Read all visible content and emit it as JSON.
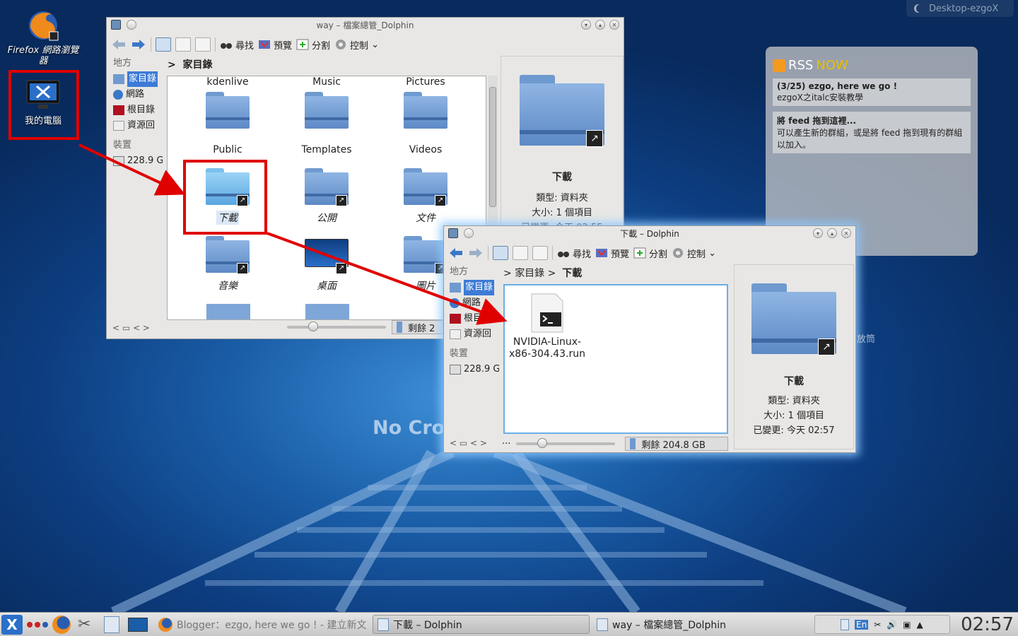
{
  "desktop": {
    "activity_label": "Desktop-ezgoX",
    "watermark": "No Cros",
    "icons": [
      {
        "label": "Firefox 網路瀏覽器"
      },
      {
        "label": "我的電腦"
      }
    ]
  },
  "win1": {
    "title": "way – 檔案總管_Dolphin",
    "toolbar": {
      "find": "尋找",
      "preview": "預覽",
      "split": "分割",
      "control": "控制"
    },
    "breadcrumb": [
      "家目錄"
    ],
    "places_header": "地方",
    "places": [
      "家目錄",
      "網路",
      "根目錄",
      "資源回"
    ],
    "devices_header": "裝置",
    "device": "228.9 G",
    "items": [
      {
        "label": "kdenlive"
      },
      {
        "label": "Music"
      },
      {
        "label": "Pictures"
      },
      {
        "label": "Public"
      },
      {
        "label": "Templates"
      },
      {
        "label": "Videos"
      },
      {
        "label": "下載"
      },
      {
        "label": "公開"
      },
      {
        "label": "文件"
      },
      {
        "label": "音樂"
      },
      {
        "label": "桌面"
      },
      {
        "label": "圖片"
      }
    ],
    "info": {
      "name": "下載",
      "type_k": "類型:",
      "type_v": "資料夾",
      "size_k": "大小:",
      "size_v": "1 個項目",
      "mod_k": "已變更:",
      "mod_v": "今天 02:55"
    },
    "free": "剩餘 2"
  },
  "win2": {
    "title": "下載 – Dolphin",
    "toolbar": {
      "find": "尋找",
      "preview": "預覽",
      "split": "分割",
      "control": "控制"
    },
    "breadcrumb": [
      "家目錄",
      "下載"
    ],
    "places_header": "地方",
    "places": [
      "家目錄",
      "網路",
      "根目錄",
      "資源回"
    ],
    "devices_header": "裝置",
    "device": "228.9 G",
    "file": "NVIDIA-Linux-x86-304.43.run",
    "file_line1": "NVIDIA-Linux-",
    "file_line2": "x86-304.43.run",
    "info": {
      "name": "下載",
      "type_k": "類型:",
      "type_v": "資料夾",
      "size_k": "大小:",
      "size_v": "1 個項目",
      "mod_k": "已變更:",
      "mod_v": "今天 02:57"
    },
    "free": "剩餘 204.8 GB",
    "dots": "···",
    "behind_text": "放筒"
  },
  "rss": {
    "brand_a": "RSS",
    "brand_b": "NOW",
    "entries": [
      {
        "title": "(3/25) ezgo, here we go !",
        "body": "ezgoX之italc安裝教學"
      },
      {
        "title": "將 feed 拖到這裡...",
        "body": "可以產生新的群組，或是將 feed 拖到現有的群組以加入。"
      }
    ]
  },
  "taskbar": {
    "tasks": [
      "Blogger：ezgo, here we go ! - 建立新文章",
      "下載 – Dolphin",
      "way – 檔案總管_Dolphin"
    ],
    "tray_lang": "En",
    "clock": "02:57"
  }
}
